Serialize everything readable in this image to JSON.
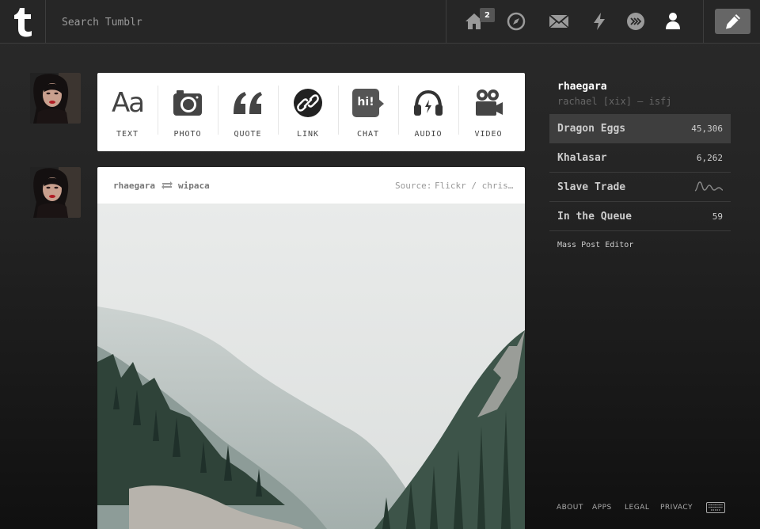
{
  "header": {
    "search_placeholder": "Search Tumblr",
    "inbox_badge": "2",
    "nav_icons": [
      "home-icon",
      "explore-compass-icon",
      "mail-icon",
      "activity-lightning-icon",
      "blog-network-icon",
      "account-icon"
    ],
    "compose_icon": "pencil-icon"
  },
  "post_types": [
    {
      "label": "TEXT",
      "icon": "text-aa-icon"
    },
    {
      "label": "PHOTO",
      "icon": "camera-icon"
    },
    {
      "label": "QUOTE",
      "icon": "quote-icon"
    },
    {
      "label": "LINK",
      "icon": "link-icon"
    },
    {
      "label": "CHAT",
      "icon": "chat-bubble-icon"
    },
    {
      "label": "AUDIO",
      "icon": "headphones-icon"
    },
    {
      "label": "VIDEO",
      "icon": "video-camera-icon"
    }
  ],
  "text_icon_glyph": "Aa",
  "chat_icon_glyph": "hi!",
  "post": {
    "author": "rhaegara",
    "reblogged_from": "wipaca",
    "source_label": "Source:",
    "source": "Flickr / chris…"
  },
  "sidebar": {
    "blog_name": "rhaegara",
    "blog_title": "rachael [xix] — isfj",
    "rows": [
      {
        "label": "Dragon Eggs",
        "count": "45,306"
      },
      {
        "label": "Khalasar",
        "count": "6,262"
      },
      {
        "label": "Slave Trade",
        "count": ""
      },
      {
        "label": "In the Queue",
        "count": "59"
      }
    ],
    "mass_post_editor": "Mass Post Editor"
  },
  "footer": {
    "about": "ABOUT",
    "apps": "APPS",
    "legal": "LEGAL",
    "privacy": "PRIVACY"
  },
  "colors": {
    "header_bg": "#262626",
    "page_bg_top": "#2a2a2a",
    "page_bg_bottom": "#101010",
    "active_row_bg": "#3e3e3e",
    "compose_bg": "#666666"
  }
}
